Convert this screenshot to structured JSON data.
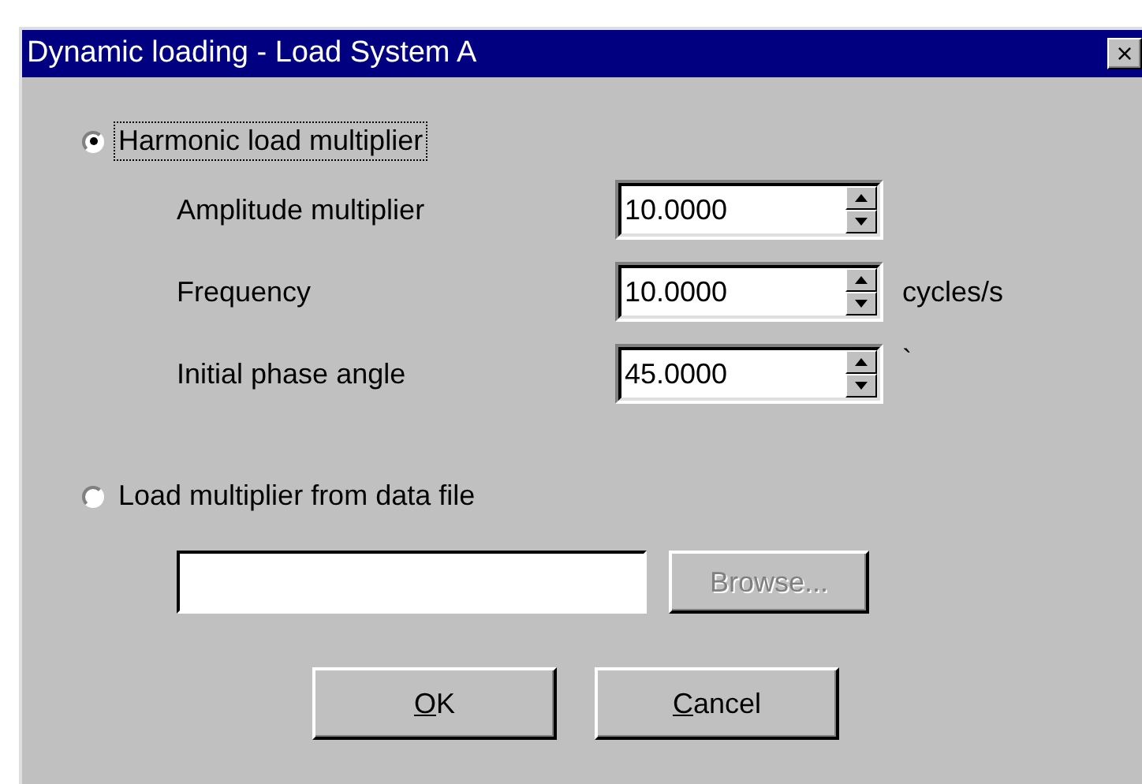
{
  "window": {
    "title": "Dynamic loading - Load System A",
    "close_icon": "×"
  },
  "options": [
    {
      "label": "Harmonic load multiplier",
      "selected": true,
      "focused": true
    },
    {
      "label": "Load multiplier from data file",
      "selected": false,
      "focused": false
    }
  ],
  "parameters": [
    {
      "label": "Amplitude multiplier",
      "value": "10.0000"
    },
    {
      "label": "Frequency",
      "value": "10.0000",
      "unit": "cycles/s"
    },
    {
      "label": "Initial phase angle",
      "value": "45.0000",
      "unit": "`"
    }
  ],
  "file": {
    "browse": {
      "label": "Browse...",
      "disabled": true
    }
  },
  "buttons": [
    {
      "label": "OK"
    },
    {
      "label": "Cancel"
    }
  ]
}
